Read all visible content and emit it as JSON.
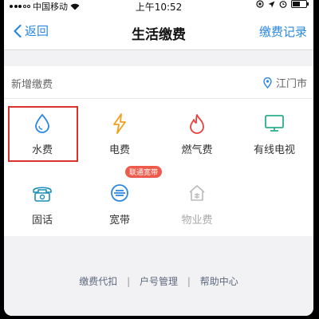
{
  "status_bar": {
    "carrier": "中国移动",
    "time": "上午10:52"
  },
  "nav": {
    "back_label": "返回",
    "title": "生活缴费",
    "record_label": "缴费记录"
  },
  "section": {
    "label": "新增缴费",
    "city": "江门市"
  },
  "items": [
    {
      "label": "水费",
      "icon": "water-drop-icon",
      "color": "#2a88e0"
    },
    {
      "label": "电费",
      "icon": "lightning-icon",
      "color": "#f0a020"
    },
    {
      "label": "燃气费",
      "icon": "flame-icon",
      "color": "#e6413e"
    },
    {
      "label": "有线电视",
      "icon": "tv-icon",
      "color": "#2cae8e"
    },
    {
      "label": "固话",
      "icon": "telephone-icon",
      "color": "#1a8fb8"
    },
    {
      "label": "宽带",
      "icon": "broadband-icon",
      "color": "#2a88e0"
    },
    {
      "label": "物业费",
      "icon": "property-house-icon",
      "color": "#bbbbbb"
    }
  ],
  "badge": "联通宽带",
  "footer_links": [
    "缴费代扣",
    "户号管理",
    "帮助中心"
  ]
}
